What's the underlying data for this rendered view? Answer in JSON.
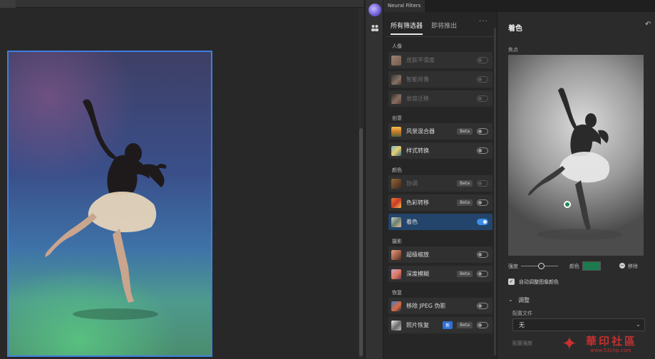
{
  "panel": {
    "title": "Neural Filters"
  },
  "tabs": [
    {
      "label": "所有筛选器"
    },
    {
      "label": "即将推出"
    }
  ],
  "menu_icon": "more-horizontal-icon",
  "categories": {
    "portrait": "人像",
    "creative": "创意",
    "color": "颜色",
    "photography": "摄影",
    "restoration": "恢复"
  },
  "filters": [
    {
      "label": "皮肤平滑度",
      "badge": "",
      "enabled": false,
      "disabled": true
    },
    {
      "label": "智能肖像",
      "badge": "",
      "enabled": false,
      "disabled": true
    },
    {
      "label": "妆容迁移",
      "badge": "",
      "enabled": false,
      "disabled": true
    },
    {
      "label": "风景混合器",
      "badge": "Beta",
      "enabled": false,
      "disabled": false
    },
    {
      "label": "样式转换",
      "badge": "",
      "enabled": false,
      "disabled": false
    },
    {
      "label": "协调",
      "badge": "Beta",
      "enabled": false,
      "disabled": true
    },
    {
      "label": "色彩转移",
      "badge": "Beta",
      "enabled": false,
      "disabled": false
    },
    {
      "label": "着色",
      "badge": "",
      "enabled": true,
      "disabled": false,
      "selected": true
    },
    {
      "label": "超级缩放",
      "badge": "",
      "enabled": false,
      "disabled": false
    },
    {
      "label": "深度模糊",
      "badge": "Beta",
      "enabled": false,
      "disabled": false
    },
    {
      "label": "移除 JPEG 伪影",
      "badge": "",
      "enabled": false,
      "disabled": false
    },
    {
      "label": "照片恢复",
      "badge": "Beta",
      "badge_new": "新",
      "enabled": false,
      "disabled": false
    }
  ],
  "settings": {
    "title": "着色",
    "focus_label": "焦点",
    "strength_label": "强度",
    "strength_fraction": 0.55,
    "color_label": "颜色",
    "color_value": "#1c7a4e",
    "remove_label": "移除",
    "auto_adjust_label": "自动调整图像颜色",
    "auto_adjust_checked": true,
    "adjust_section_label": "调整",
    "profile_label": "配置文件",
    "profile_value": "无",
    "saturation_label": "配置强度"
  },
  "watermark": {
    "cn": "華印社區",
    "url": "www.52cnp.com"
  }
}
